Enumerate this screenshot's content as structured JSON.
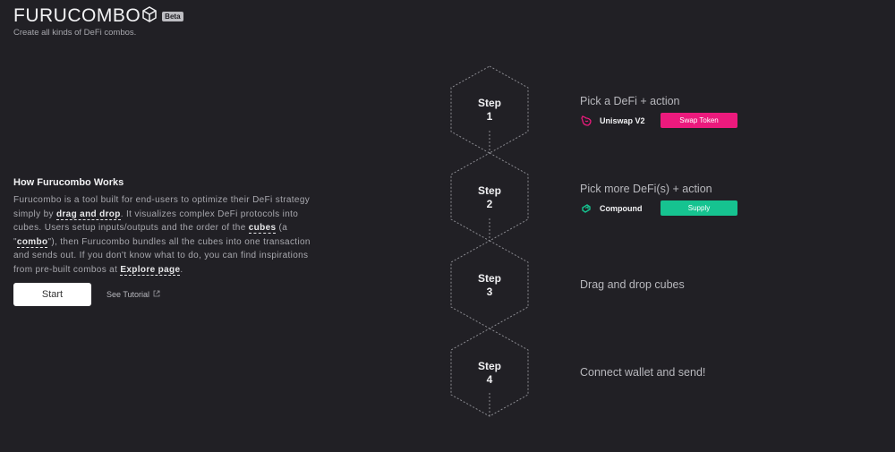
{
  "brand": {
    "logo_text": "FURUCOMBO",
    "beta": "Beta",
    "tagline": "Create all kinds of DeFi combos."
  },
  "intro": {
    "title": "How Furucombo Works",
    "p1": "Furucombo is a tool built for end-users to optimize their DeFi strategy simply by ",
    "link_drag": "drag and drop",
    "p2": ". It visualizes complex DeFi protocols into cubes. Users setup inputs/outputs and the order of the ",
    "link_cubes": "cubes",
    "p3": " (a \"",
    "link_combo": "combo",
    "p4": "\"), then Furucombo bundles all the cubes into one transaction and sends out. If you don't know what to do, you can find inspirations from pre-built combos at ",
    "link_explore": "Explore page",
    "p5": "."
  },
  "actions": {
    "start_label": "Start",
    "tutorial_label": "See Tutorial"
  },
  "steps": [
    {
      "word": "Step",
      "number": "1",
      "description": "Pick a DeFi + action",
      "protocol": "Uniswap V2",
      "action": "Swap Token",
      "action_color": "#ec1a7d"
    },
    {
      "word": "Step",
      "number": "2",
      "description": "Pick more DeFi(s) + action",
      "protocol": "Compound",
      "action": "Supply",
      "action_color": "#16c390"
    },
    {
      "word": "Step",
      "number": "3",
      "description": "Drag and drop cubes"
    },
    {
      "word": "Step",
      "number": "4",
      "description": "Connect wallet and send!"
    }
  ],
  "colors": {
    "background": "#212025",
    "uniswap": "#ec1a7d",
    "compound": "#16c390"
  },
  "icons": {
    "logo_cube": "cube-icon",
    "uniswap": "uniswap-unicorn-icon",
    "compound": "compound-icon",
    "external": "external-link-icon"
  }
}
